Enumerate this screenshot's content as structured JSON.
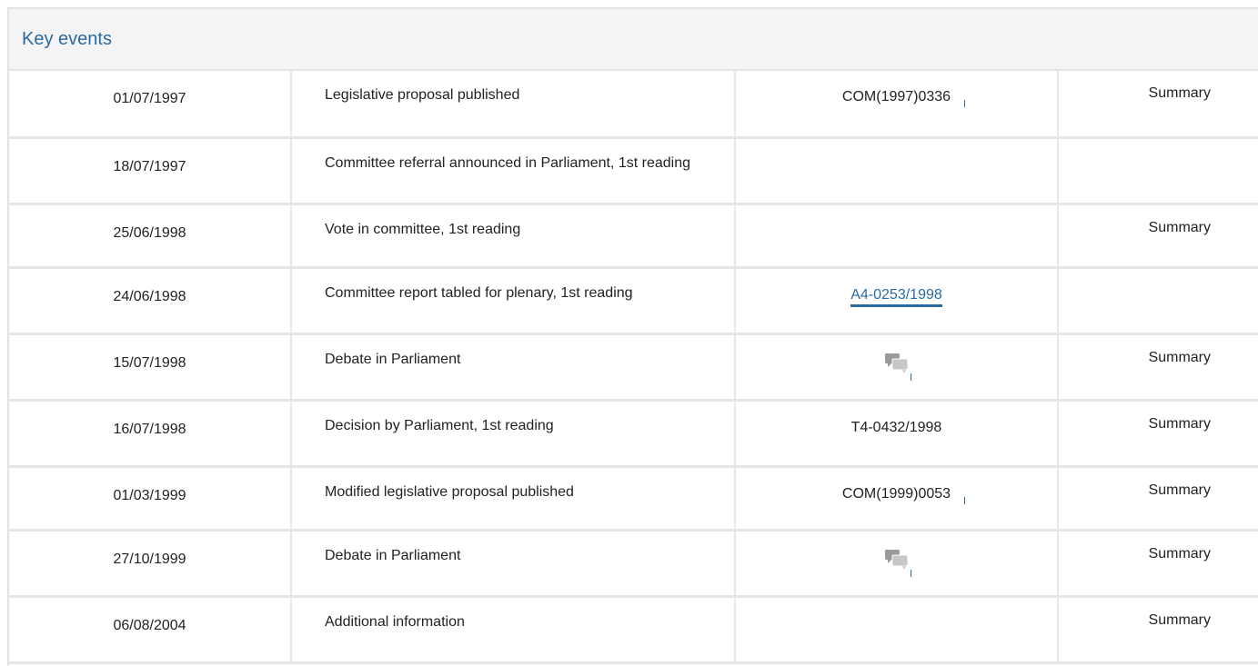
{
  "header": {
    "title": "Key events"
  },
  "rows": [
    {
      "date": "01/07/1997",
      "event": "Legislative proposal published",
      "doc": "COM(1997)0336",
      "summary": "Summary"
    },
    {
      "date": "18/07/1997",
      "event": "Committee referral announced in Parliament, 1st reading",
      "doc": "",
      "summary": ""
    },
    {
      "date": "25/06/1998",
      "event": "Vote in committee, 1st reading",
      "doc": "",
      "summary": "Summary"
    },
    {
      "date": "24/06/1998",
      "event": "Committee report tabled for plenary, 1st reading",
      "doc": "A4-0253/1998",
      "summary": ""
    },
    {
      "date": "15/07/1998",
      "event": "Debate in Parliament",
      "doc": "",
      "summary": "Summary"
    },
    {
      "date": "16/07/1998",
      "event": "Decision by Parliament, 1st reading",
      "doc": "T4-0432/1998",
      "summary": "Summary"
    },
    {
      "date": "01/03/1999",
      "event": "Modified legislative proposal published",
      "doc": "COM(1999)0053",
      "summary": "Summary"
    },
    {
      "date": "27/10/1999",
      "event": "Debate in Parliament",
      "doc": "",
      "summary": "Summary"
    },
    {
      "date": "06/08/2004",
      "event": "Additional information",
      "doc": "",
      "summary": "Summary"
    }
  ],
  "icons": {
    "debate": "debate-speech-bubbles-icon"
  },
  "colors": {
    "link": "#2a6aa3",
    "header_bg": "#f4f4f4",
    "border": "#e6e6e6"
  }
}
